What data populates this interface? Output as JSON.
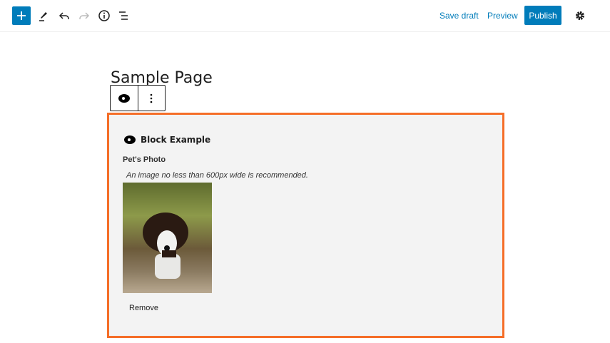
{
  "topbar": {
    "save_draft": "Save draft",
    "preview": "Preview",
    "publish": "Publish"
  },
  "page": {
    "title": "Sample Page"
  },
  "block": {
    "title": "Block Example",
    "field_label": "Pet's Photo",
    "help": "An image no less than 600px wide is recommended.",
    "remove": "Remove"
  },
  "colors": {
    "accent": "#007cba",
    "selection": "#f56e28"
  }
}
